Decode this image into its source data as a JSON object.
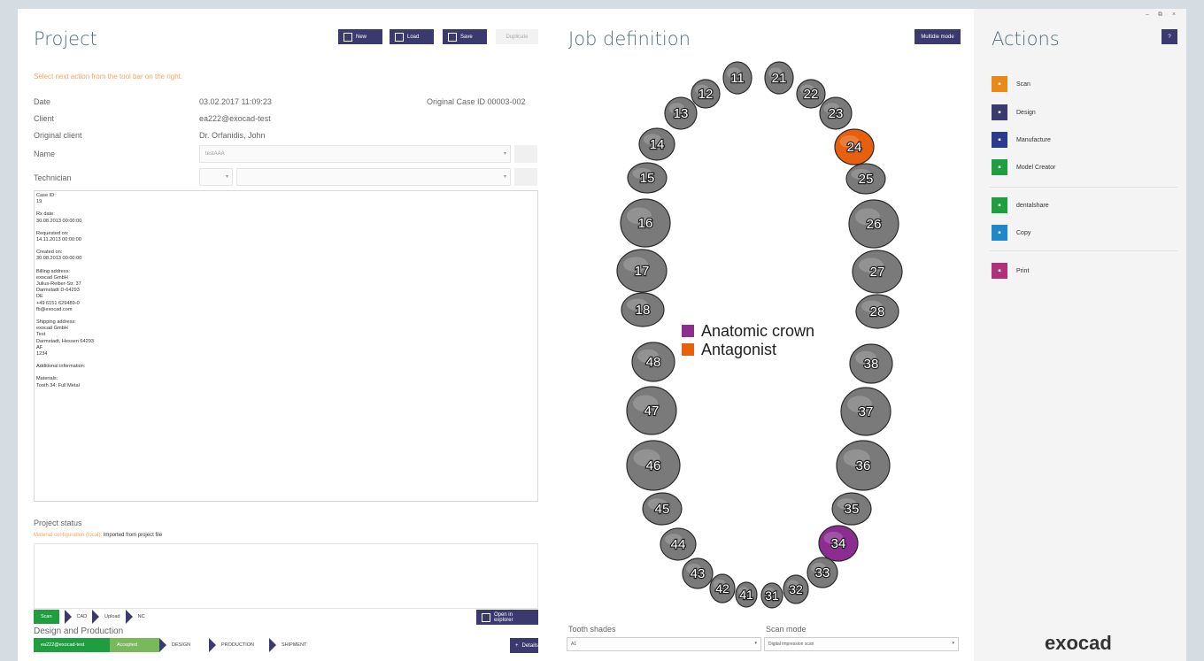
{
  "project": {
    "title": "Project",
    "new_label": "New",
    "load_label": "Load",
    "save_label": "Save",
    "duplicate_label": "Duplicate",
    "hint": "Select next action from the tool bar on the right.",
    "date_label": "Date",
    "date_value": "03.02.2017 11:09:23",
    "original_case_id": "Original Case ID 00003-002",
    "client_label": "Client",
    "client_value": "ea222@exocad-test",
    "original_client_label": "Original client",
    "original_client_value": "Dr. Orfanidis, John",
    "name_label": "Name",
    "name_value": "testAAA",
    "technician_label": "Technician",
    "notes": [
      "Case ID:\n19",
      "Rx date:\n30.08.2013 00:00:00",
      "Requested on:\n14.11.2013 00:00:00",
      "Created on:\n30.08.2013 00:00:00",
      "Billing address:\nexocad GmbH\nJulius-Reiber-Str. 37\nDarmstadt D-64293\nDE\n+49 6151 629489-0\nfb@exocad.com",
      "Shipping address:\nexocad GmbH\nTest\nDarmstadt, Hessen 64293\nAF\n1234",
      "Additional information:",
      "Materials:\nTooth 34: Full Metal"
    ],
    "status_label": "Project status",
    "material_config": "Material configuration (local):",
    "material_source": "Imported from project file",
    "workflow": [
      "Scan",
      "CAD",
      "Upload",
      "NC"
    ],
    "open_explorer": "Open in explorer",
    "design_production": "Design and Production",
    "production_steps": [
      "ea222@exocad-test",
      "Accepted",
      "DESIGN",
      "PRODUCTION",
      "SHIPMENT"
    ],
    "details_label": "Details"
  },
  "job": {
    "title": "Job definition",
    "multidie": "Multidie mode",
    "legend": [
      {
        "label": "Anatomic crown",
        "color": "#8b2d91"
      },
      {
        "label": "Antagonist",
        "color": "#e8600e"
      }
    ],
    "teeth": [
      "11",
      "12",
      "13",
      "14",
      "15",
      "16",
      "17",
      "18",
      "21",
      "22",
      "23",
      "24",
      "25",
      "26",
      "27",
      "28",
      "31",
      "32",
      "33",
      "34",
      "35",
      "36",
      "37",
      "38",
      "41",
      "42",
      "43",
      "44",
      "45",
      "46",
      "47",
      "48"
    ],
    "highlighted": {
      "24": "antagonist",
      "34": "anatomic"
    },
    "tooth_shades_label": "Tooth shades",
    "tooth_shades_value": "A1",
    "scan_mode_label": "Scan mode",
    "scan_mode_value": "Digital impression scan"
  },
  "actions": {
    "title": "Actions",
    "help": "?",
    "items": [
      {
        "label": "Scan",
        "color": "#e88a1a",
        "icon": "scan-icon"
      },
      {
        "label": "Design",
        "color": "#3b3a6e",
        "icon": "design-icon"
      },
      {
        "label": "Manufacture",
        "color": "#2a3b8f",
        "icon": "manufacture-icon"
      },
      {
        "label": "Model Creator",
        "color": "#1e9e3e",
        "icon": "model-creator-icon"
      },
      {
        "label": "dentalshare",
        "color": "#1e9e3e",
        "icon": "dentalshare-icon"
      },
      {
        "label": "Copy",
        "color": "#1e88c8",
        "icon": "copy-icon"
      },
      {
        "label": "Print",
        "color": "#b0307a",
        "icon": "print-icon"
      }
    ],
    "logo": "exocad"
  }
}
